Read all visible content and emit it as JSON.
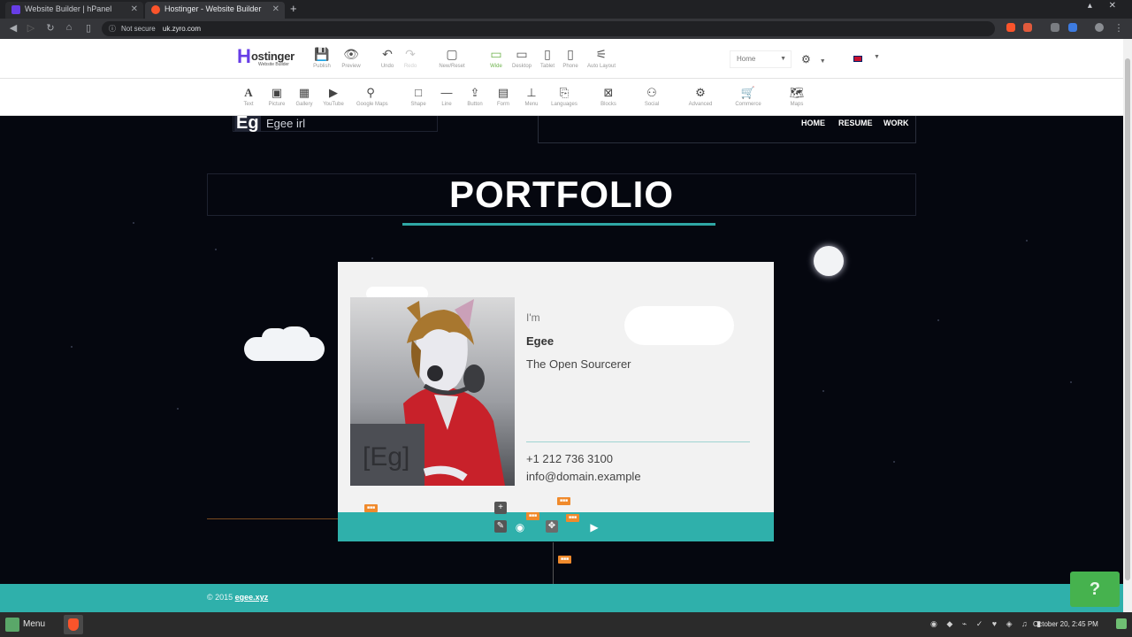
{
  "browser": {
    "tabs": [
      {
        "title": "Website Builder | hPanel",
        "active": false
      },
      {
        "title": "Hostinger - Website Builder",
        "active": true
      }
    ],
    "security_label": "Not secure",
    "url": "uk.zyro.com"
  },
  "builder": {
    "logo_name": "ostinger",
    "logo_mark": "H",
    "logo_sub": "Website Builder",
    "top_actions": [
      {
        "icon": "save-icon",
        "label": "Publish"
      },
      {
        "icon": "eye-icon",
        "label": "Preview"
      },
      {
        "icon": "undo-icon",
        "label": "Undo"
      },
      {
        "icon": "redo-icon",
        "label": "Redo"
      },
      {
        "icon": "page-icon",
        "label": "New/Reset"
      },
      {
        "icon": "wide-screen-icon",
        "label": "Wide"
      },
      {
        "icon": "laptop-icon",
        "label": "Desktop"
      },
      {
        "icon": "tablet-icon",
        "label": "Tablet"
      },
      {
        "icon": "phone-icon",
        "label": "Phone"
      },
      {
        "icon": "auto-layout-icon",
        "label": "Auto Layout"
      }
    ],
    "page_select": "Home",
    "elements": [
      {
        "icon": "text-icon",
        "label": "Text"
      },
      {
        "icon": "picture-icon",
        "label": "Picture"
      },
      {
        "icon": "gallery-icon",
        "label": "Gallery"
      },
      {
        "icon": "youtube-icon",
        "label": "YouTube"
      },
      {
        "icon": "map-pin-icon",
        "label": "Google Maps"
      },
      {
        "icon": "shape-icon",
        "label": "Shape"
      },
      {
        "icon": "line-icon",
        "label": "Line"
      },
      {
        "icon": "button-icon",
        "label": "Button"
      },
      {
        "icon": "form-icon",
        "label": "Form"
      },
      {
        "icon": "menu-icon",
        "label": "Menu"
      },
      {
        "icon": "languages-icon",
        "label": "Languages"
      },
      {
        "icon": "blocks-icon",
        "label": "Blocks"
      },
      {
        "icon": "social-icon",
        "label": "Social"
      },
      {
        "icon": "advanced-icon",
        "label": "Advanced"
      },
      {
        "icon": "commerce-icon",
        "label": "Commerce"
      },
      {
        "icon": "maps-icon",
        "label": "Maps"
      }
    ]
  },
  "site": {
    "logo": "Eg",
    "name": "Egee irl",
    "nav": [
      "HOME",
      "RESUME",
      "WORK"
    ],
    "title": "PORTFOLIO",
    "card": {
      "intro": "I'm",
      "name": "Egee",
      "tagline": "The Open Sourcerer",
      "phone": "+1 212 736 3100",
      "email": "info@domain.example"
    },
    "footer_text": "© 2015",
    "footer_link": "egee.xyz"
  },
  "help_label": "?",
  "taskbar": {
    "menu_label": "Menu",
    "clock": "October 20, 2:45 PM"
  },
  "colors": {
    "accent": "#2fb0ab",
    "background": "#05070f",
    "brand": "#673de6",
    "tag": "#f08a2c"
  }
}
